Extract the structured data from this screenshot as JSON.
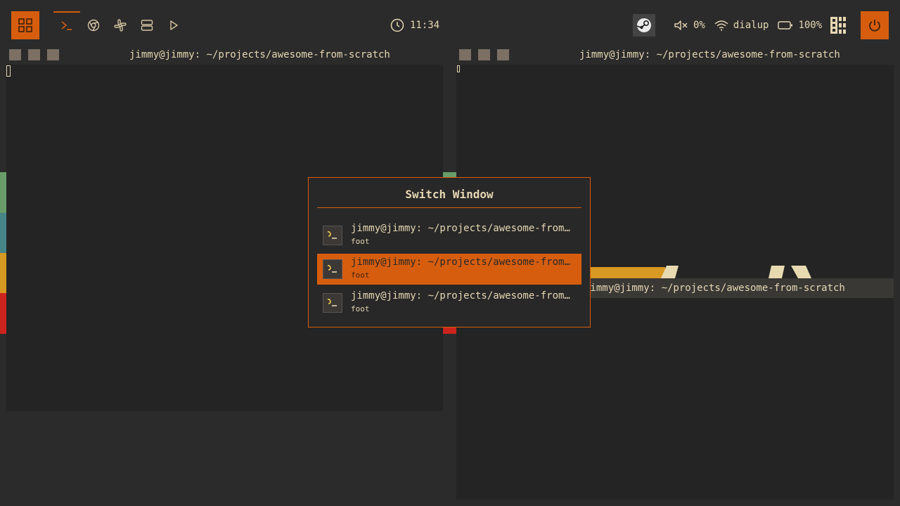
{
  "topbar": {
    "clock": "11:34",
    "volume": "0%",
    "network": "dialup",
    "battery": "100%",
    "tags": [
      {
        "icon": "terminal-icon",
        "active": true
      },
      {
        "icon": "chrome-icon",
        "active": false
      },
      {
        "icon": "slack-icon",
        "active": false
      },
      {
        "icon": "server-icon",
        "active": false
      },
      {
        "icon": "play-icon",
        "active": false
      }
    ]
  },
  "windows": {
    "left_title": "jimmy@jimmy: ~/projects/awesome-from-scratch",
    "right_title": "jimmy@jimmy: ~/projects/awesome-from-scratch",
    "tooltip": "jimmy@jimmy: ~/projects/awesome-from-scratch"
  },
  "switcher": {
    "title": "Switch Window",
    "items": [
      {
        "name": "jimmy@jimmy: ~/projects/awesome-from-scratch",
        "class": "foot"
      },
      {
        "name": "jimmy@jimmy: ~/projects/awesome-from-scratch",
        "class": "foot"
      },
      {
        "name": "jimmy@jimmy: ~/projects/awesome-from-scratch",
        "class": "foot"
      }
    ]
  },
  "colors": {
    "accent": "#d65d0e",
    "background": "#2b2b2b",
    "terminal": "#242424",
    "foreground": "#e6d7b3"
  }
}
